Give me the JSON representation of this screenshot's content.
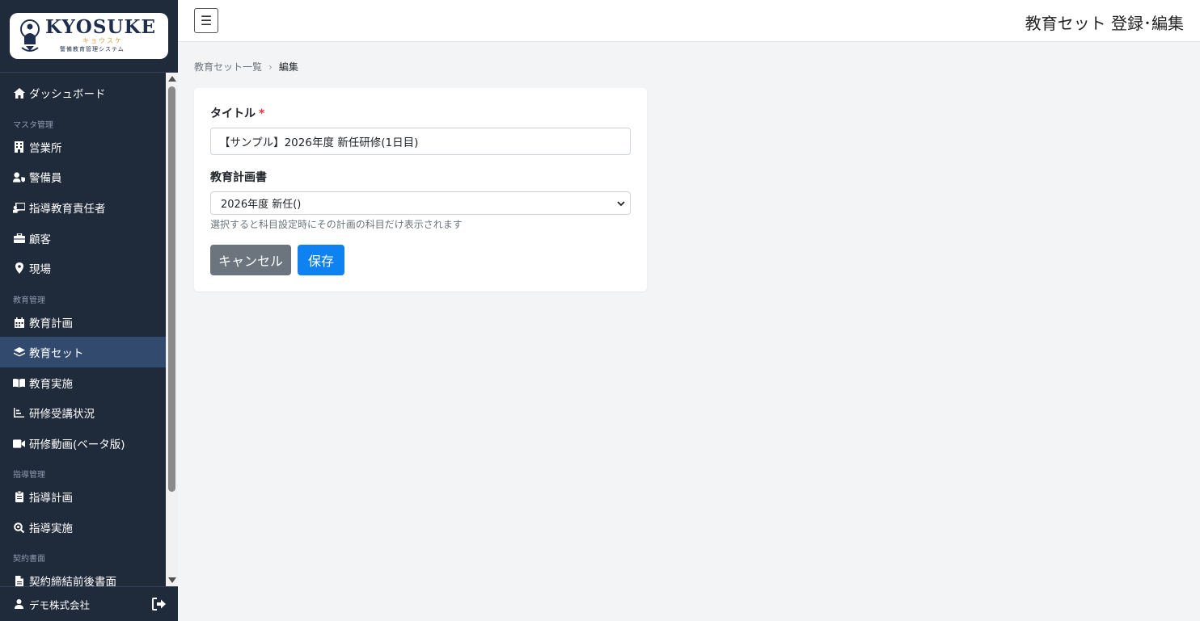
{
  "logo": {
    "main": "KYOSUKE",
    "kana": "キョウスケ",
    "sub": "警備教育管理システム"
  },
  "sidebar": {
    "items": [
      {
        "label": "ダッシュボード",
        "icon": "home-icon"
      },
      {
        "label": "営業所",
        "icon": "building-icon"
      },
      {
        "label": "警備員",
        "icon": "user-shield-icon"
      },
      {
        "label": "指導教育責任者",
        "icon": "chalkboard-teacher-icon"
      },
      {
        "label": "顧客",
        "icon": "briefcase-icon"
      },
      {
        "label": "現場",
        "icon": "map-marker-icon"
      },
      {
        "label": "教育計画",
        "icon": "calendar-icon"
      },
      {
        "label": "教育セット",
        "icon": "layers-icon"
      },
      {
        "label": "教育実施",
        "icon": "book-open-icon"
      },
      {
        "label": "研修受講状況",
        "icon": "chart-bar-icon"
      },
      {
        "label": "研修動画(ベータ版)",
        "icon": "video-icon"
      },
      {
        "label": "指導計画",
        "icon": "clipboard-icon"
      },
      {
        "label": "指導実施",
        "icon": "search-icon"
      },
      {
        "label": "契約締結前後書面",
        "icon": "file-icon"
      }
    ],
    "sections": [
      "マスタ管理",
      "教育管理",
      "指導管理",
      "契約書面"
    ],
    "active_item": "教育セット"
  },
  "user": {
    "name": "デモ株式会社"
  },
  "header": {
    "title": "教育セット 登録･編集",
    "menu_toggle": "☰"
  },
  "breadcrumb": {
    "parent": "教育セット一覧",
    "separator": "›",
    "current": "編集"
  },
  "form": {
    "title_label": "タイトル",
    "required_mark": "*",
    "title_value": "【サンプル】2026年度 新任研修(1日目)",
    "plan_label": "教育計画書",
    "plan_selected": "2026年度 新任()",
    "plan_help": "選択すると科目設定時にその計画の科目だけ表示されます",
    "cancel_label": "キャンセル",
    "save_label": "保存"
  },
  "colors": {
    "sidebar_bg": "#1f2a3a",
    "sidebar_active": "#314a6e",
    "primary": "#0d82f0",
    "secondary": "#6c757d",
    "required": "#dc3545"
  }
}
